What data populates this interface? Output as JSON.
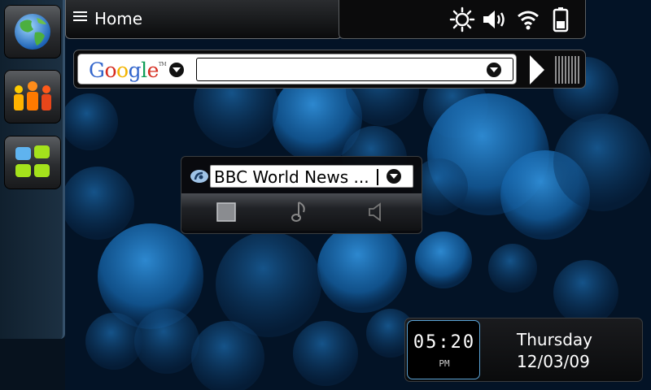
{
  "status_bar": {
    "title": "Home",
    "icons": [
      "brightness-icon",
      "volume-icon",
      "wifi-icon",
      "battery-icon"
    ]
  },
  "launcher": {
    "items": [
      {
        "icon": "globe-icon"
      },
      {
        "icon": "people-icon"
      },
      {
        "icon": "apps-grid-icon"
      }
    ]
  },
  "google_widget": {
    "logo_text": "Google",
    "logo_mark": "TM",
    "search_value": "",
    "logo_colors": [
      "#3366cc",
      "#d62d20",
      "#f2b400",
      "#3366cc",
      "#0f9d58",
      "#d62d20"
    ]
  },
  "radio_widget": {
    "station": "BBC World News ..."
  },
  "clock_widget": {
    "time": "05:20",
    "ampm": "PM",
    "day": "Thursday",
    "date": "12/03/09"
  },
  "colors": {
    "background": "#02101f",
    "bubble": "#1b6fb8",
    "clock_border": "#5aa3d6"
  }
}
